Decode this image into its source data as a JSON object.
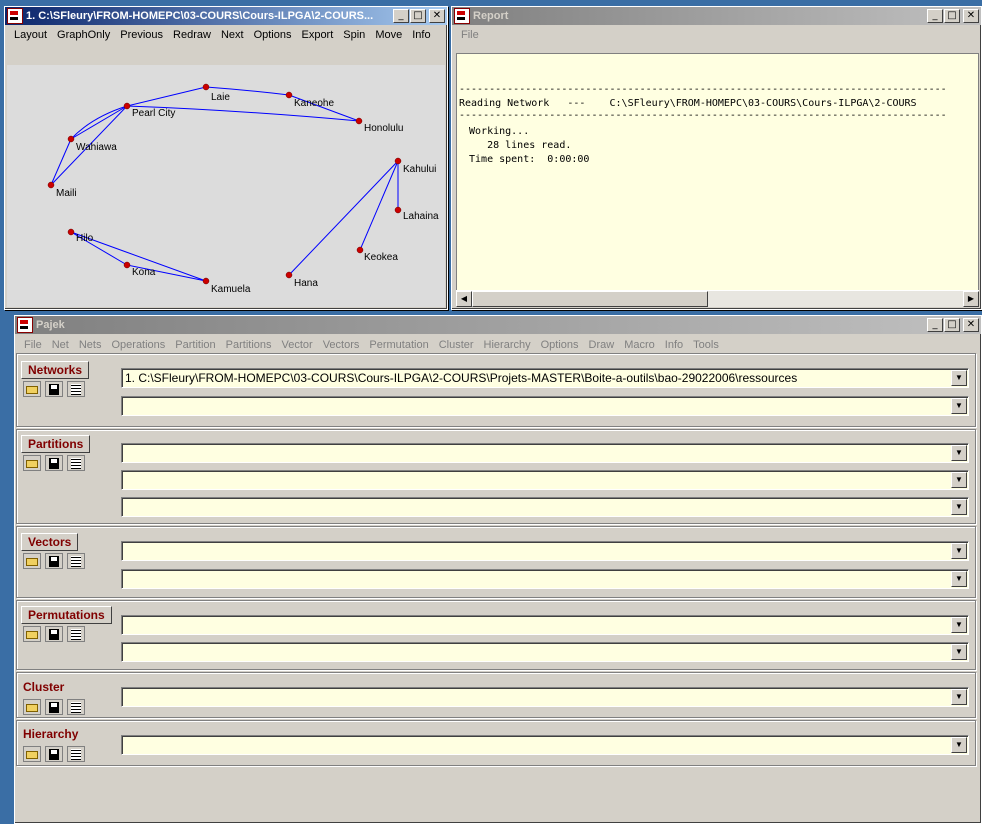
{
  "graph_window": {
    "title": "1. C:\\SFleury\\FROM-HOMEPC\\03-COURS\\Cours-ILPGA\\2-COURS...",
    "menu": [
      "Layout",
      "GraphOnly",
      "Previous",
      "Redraw",
      "Next",
      "Options",
      "Export",
      "Spin",
      "Move",
      "Info"
    ],
    "nodes": [
      {
        "label": "Laie"
      },
      {
        "label": "Kaneohe"
      },
      {
        "label": "Pearl City"
      },
      {
        "label": "Honolulu"
      },
      {
        "label": "Wahiawa"
      },
      {
        "label": "Maili"
      },
      {
        "label": "Kahului"
      },
      {
        "label": "Lahaina"
      },
      {
        "label": "Hilo"
      },
      {
        "label": "Keokea"
      },
      {
        "label": "Kona"
      },
      {
        "label": "Hana"
      },
      {
        "label": "Kamuela"
      }
    ],
    "edge_color": "#0000ff",
    "node_color": "#cc0000"
  },
  "report_window": {
    "title": "Report",
    "menu": [
      "File"
    ],
    "lines": [
      "---------------------------------------------------------------------------------",
      "Reading Network   ---    C:\\SFleury\\FROM-HOMEPC\\03-COURS\\Cours-ILPGA\\2-COURS",
      "---------------------------------------------------------------------------------",
      " Working...",
      "    28 lines read.",
      " Time spent:  0:00:00"
    ]
  },
  "pajek_window": {
    "title": "Pajek",
    "menu": [
      "File",
      "Net",
      "Nets",
      "Operations",
      "Partition",
      "Partitions",
      "Vector",
      "Vectors",
      "Permutation",
      "Cluster",
      "Hierarchy",
      "Options",
      "Draw",
      "Macro",
      "Info",
      "Tools"
    ],
    "groups": {
      "networks": {
        "label": "Networks",
        "combos": [
          "1. C:\\SFleury\\FROM-HOMEPC\\03-COURS\\Cours-ILPGA\\2-COURS\\Projets-MASTER\\Boite-a-outils\\bao-29022006\\ressources",
          ""
        ]
      },
      "partitions": {
        "label": "Partitions",
        "combos": [
          "",
          "",
          ""
        ]
      },
      "vectors": {
        "label": "Vectors",
        "combos": [
          "",
          ""
        ]
      },
      "permutations": {
        "label": "Permutations",
        "combos": [
          "",
          ""
        ]
      },
      "cluster": {
        "label": "Cluster",
        "combos": [
          ""
        ]
      },
      "hierarchy": {
        "label": "Hierarchy",
        "combos": [
          ""
        ]
      }
    }
  },
  "colors": {
    "desktop": "#3a6ea5",
    "face": "#d4d0c8",
    "field": "#ffffe1",
    "accent_text": "#800000"
  }
}
